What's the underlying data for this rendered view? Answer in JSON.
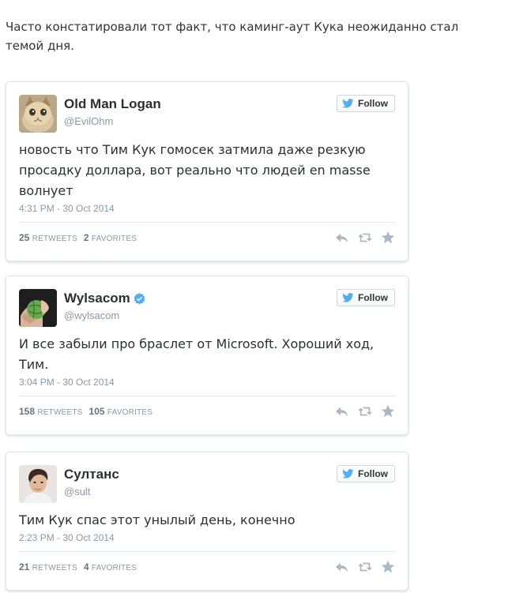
{
  "intro_text": "Часто констатировали тот факт, что каминг-аут Кука неожиданно стал темой дня.",
  "colors": {
    "twitter_blue": "#55acee",
    "icon_gray": "#8899a6",
    "verified_blue": "#55acee"
  },
  "tweets": [
    {
      "display_name": "Old Man Logan",
      "handle": "@EvilOhm",
      "verified": false,
      "avatar_icon": "cat-avatar",
      "follow_label": "Follow",
      "text": "новость что Тим Кук гомосек затмила даже резкую просадку доллара, вот реально что людей en masse волнует",
      "timestamp": "4:31 PM - 30 Oct 2014",
      "retweets": "25",
      "retweets_label": "RETWEETS",
      "favorites": "2",
      "favorites_label": "FAVORITES"
    },
    {
      "display_name": "Wylsacom",
      "handle": "@wylsacom",
      "verified": true,
      "avatar_icon": "hand-ball-avatar",
      "follow_label": "Follow",
      "text": "И все забыли про браслет от Microsoft. Хороший ход, Тим.",
      "timestamp": "3:04 PM - 30 Oct 2014",
      "retweets": "158",
      "retweets_label": "RETWEETS",
      "favorites": "105",
      "favorites_label": "FAVORITES"
    },
    {
      "display_name": "Султанс",
      "handle": "@sult",
      "verified": false,
      "avatar_icon": "man-portrait-avatar",
      "follow_label": "Follow",
      "text": "Тим Кук спас этот унылый день, конечно",
      "timestamp": "2:23 PM - 30 Oct 2014",
      "retweets": "21",
      "retweets_label": "RETWEETS",
      "favorites": "4",
      "favorites_label": "FAVORITES"
    }
  ]
}
